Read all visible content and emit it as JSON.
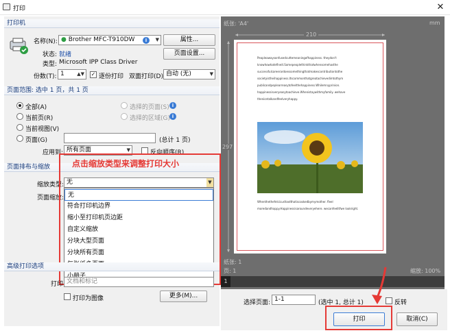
{
  "window": {
    "title": "打印",
    "close_glyph": "✕"
  },
  "printer": {
    "section": "打印机",
    "name_label": "名称(N):",
    "name_value": "Brother MFC-T910DW",
    "properties_btn": "属性...",
    "status_label": "状态:",
    "status_value": "就绪",
    "type_label": "类型:",
    "type_value": "Microsoft IPP Class Driver",
    "page_setup_btn": "页面设置...",
    "copies_label": "份数(T):",
    "copies_value": "1",
    "collate_label": "逐份打印",
    "duplex_label": "双面打印(D)",
    "duplex_value": "自动 (无)"
  },
  "range": {
    "section": "页面范围: 选中 1 页，共 1 页",
    "all": "全部(A)",
    "current_page": "当前页(R)",
    "current_view": "当前视图(V)",
    "pages": "页面(G)",
    "pages_value": "",
    "pages_total": "(总计 1 页)",
    "selected_pages": "选择的页面(S)",
    "selected_area": "选择的区域(G)",
    "apply_label": "应用到:",
    "apply_value": "所有页面",
    "reverse_label": "反向顺序(R)"
  },
  "layout": {
    "section": "页面排布与缩放",
    "scale_type_label": "缩放类型:",
    "scale_type_value": "无",
    "scale_label": "页面缩放:",
    "options": [
      "无",
      "符合打印机边界",
      "缩小至打印机页边距",
      "自定义缩放",
      "分块大型页面",
      "分块所有页面",
      "每张纸多页面",
      "小册子"
    ]
  },
  "annotation": {
    "text": "点击缩放类型来调整打印大小"
  },
  "advanced": {
    "section": "高级打印选项",
    "print_label": "打印",
    "print_value": "文档和标记",
    "as_image": "打印为图像",
    "more_btn": "更多(M)..."
  },
  "preview": {
    "paper": "纸张: 'A4'",
    "unit": "mm",
    "width": "210",
    "height": "297",
    "page_info": "纸张: 1",
    "page_info2": "页: 1",
    "zoom": "缩放: 100%",
    "page_num": "1",
    "text_top": "Peopleawaysonfusedcuttemeaningofhappiness. theydon't knowhowtodefineit.Somepeoplethinkthatwhensomehasthe successfulcareerardoessomethingthatmakescontributiontothe societyistheihappiness.Itscommonthatgreatachievedimtothym publicandpeplearreasytofeelthehappiness.Whilemnyprinion. happinessisveryeasytoachieve.Whenistaywithmyfamily. wehave thenicetalkandfeelveryhappy.",
    "text_bottom": "Whenthethefelcicusfoodthatiscookedbymymother. fleel moredandhappy.Happinessisaroundeveryehere. wecanfeelitfwe lookright."
  },
  "bottom": {
    "select_label": "选择页面:",
    "select_value": "1-1",
    "select_info": "(选中 1, 总计 1)",
    "flip_label": "反转",
    "print_btn": "打印",
    "cancel_btn": "取消(C)"
  },
  "colors": {
    "accent": "#3a7bd5",
    "annotation": "#e53935",
    "preview_bg": "#6e6e6e"
  }
}
